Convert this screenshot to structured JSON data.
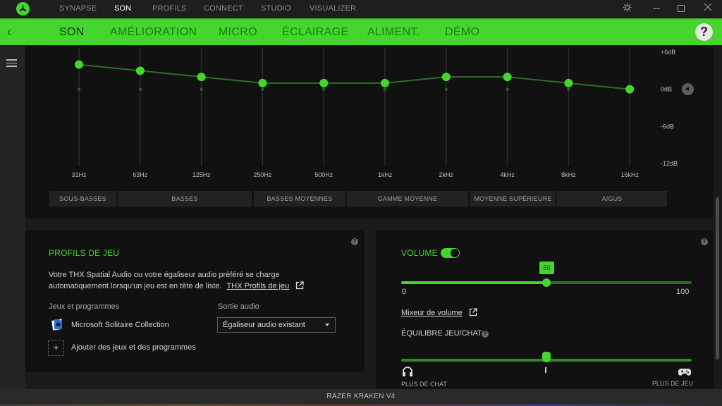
{
  "app": {
    "top_nav": [
      {
        "label": "SYNAPSE",
        "active": false
      },
      {
        "label": "SON",
        "active": true
      },
      {
        "label": "PROFILS",
        "active": false
      },
      {
        "label": "CONNECT",
        "active": false
      },
      {
        "label": "STUDIO",
        "active": false
      },
      {
        "label": "VISUALIZER",
        "active": false
      }
    ],
    "window_controls": {
      "settings_icon": "gear-icon",
      "minimize": "minimize-icon",
      "maximize": "maximize-icon",
      "close": "close-icon"
    },
    "sub_tabs": [
      {
        "label": "SON",
        "active": true
      },
      {
        "label": "AMÉLIORATION",
        "active": false
      },
      {
        "label": "MICRO",
        "active": false
      },
      {
        "label": "ÉCLAIRAGE",
        "active": false
      },
      {
        "label": "ALIMENT.",
        "active": false
      },
      {
        "label": "DÉMO",
        "active": false
      }
    ],
    "help_label": "?",
    "device_name": "RAZER KRAKEN V4"
  },
  "equalizer": {
    "frequencies": [
      "31Hz",
      "63Hz",
      "125Hz",
      "250Hz",
      "500Hz",
      "1kHz",
      "2kHz",
      "4kHz",
      "8kHz",
      "16kHz"
    ],
    "gains_db": [
      4,
      3,
      2,
      1,
      1,
      1,
      2,
      2,
      1,
      0
    ],
    "y_ticks": [
      "+6dB",
      "0dB",
      "-6dB",
      "-12dB"
    ],
    "y_range_db": [
      -12,
      6
    ],
    "bands": [
      "SOUS-BASSES",
      "BASSES",
      "BASSES MOYENNES",
      "GAMME MOYENNE",
      "MOYENNE SUPÉRIEURE",
      "AIGUS"
    ],
    "accent_color": "#44d62c"
  },
  "game_profiles": {
    "title": "PROFILS DE JEU",
    "description_line1": "Votre THX Spatial Audio ou votre égaliseur audio préféré se charge",
    "description_line2": "automatiquement lorsqu'un jeu est en tête de liste.",
    "link_label": "THX Profils de jeu",
    "col_games": "Jeux et programmes",
    "col_output": "Sortie audio",
    "games": [
      {
        "name": "Microsoft Solitaire Collection",
        "output": "Égaliseur audio existant"
      }
    ],
    "add_label": "Ajouter des jeux et des programmes"
  },
  "volume": {
    "title": "VOLUME",
    "enabled": true,
    "value": 50,
    "min_label": "0",
    "max_label": "100",
    "mixer_link": "Mixeur de volume",
    "balance_title": "ÉQUILIBRE JEU/CHAT",
    "balance_value": 0.5,
    "balance_left": "PLUS DE CHAT",
    "balance_right": "PLUS DE JEU"
  }
}
